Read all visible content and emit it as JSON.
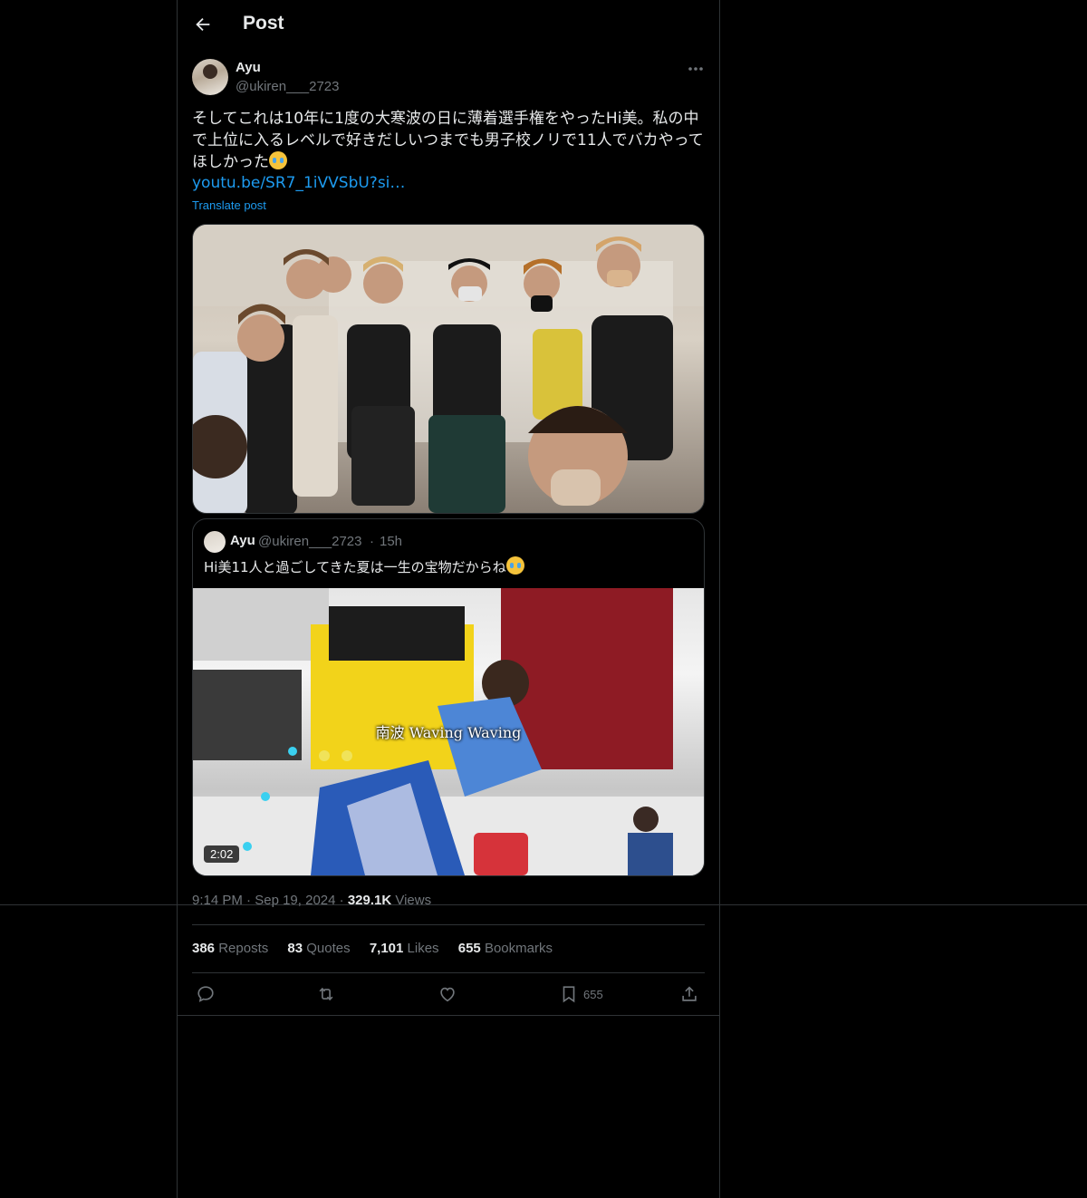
{
  "header": {
    "title": "Post"
  },
  "post": {
    "author_name": "Ayu",
    "author_handle": "@ukiren___2723",
    "text": "そしてこれは10年に1度の大寒波の日に薄着選手権をやったHi美。私の中で上位に入るレベルで好きだしいつまでも男子校ノリで11人でバカやってほしかった",
    "link": "youtu.be/SR7_1iVVSbU?si…",
    "translate_label": "Translate post"
  },
  "quote": {
    "author_name": "Ayu",
    "author_handle": "@ukiren___2723",
    "separator": "·",
    "time": "15h",
    "text": "Hi美11人と過ごしてきた夏は一生の宝物だからね",
    "video_caption": "南波 Waving Waving",
    "video_duration": "2:02"
  },
  "meta": {
    "time": "9:14 PM",
    "sep1": "·",
    "date": "Sep 19, 2024",
    "sep2": "·",
    "views_count": "329.1K",
    "views_label": "Views"
  },
  "stats": {
    "reposts_count": "386",
    "reposts_label": "Reposts",
    "quotes_count": "83",
    "quotes_label": "Quotes",
    "likes_count": "7,101",
    "likes_label": "Likes",
    "bookmarks_count": "655",
    "bookmarks_label": "Bookmarks"
  },
  "actions": {
    "bookmark_count": "655"
  },
  "icons": [
    "back-arrow-icon",
    "more-icon",
    "reply-icon",
    "repost-icon",
    "like-icon",
    "bookmark-icon",
    "share-icon",
    "crying-emoji-icon"
  ],
  "colors": {
    "background": "#000000",
    "text": "#e7e9ea",
    "secondary": "#71767b",
    "link": "#1d9bf0",
    "border": "#2f3336"
  }
}
